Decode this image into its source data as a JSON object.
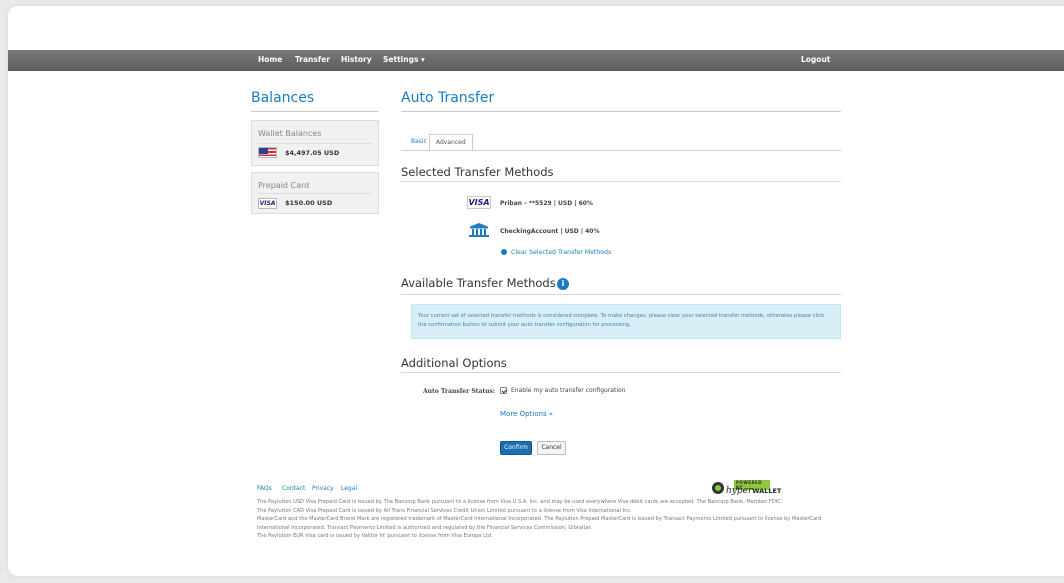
{
  "nav": {
    "home": "Home",
    "transfer": "Transfer",
    "history": "History",
    "settings": "Settings ▾",
    "logout": "Logout"
  },
  "balances": {
    "title": "Balances",
    "wallet": {
      "title": "Wallet Balances",
      "amount": "$4,497.05 USD",
      "icon": "us-flag-icon"
    },
    "prepaid": {
      "title": "Prepaid Card",
      "amount": "$150.00 USD",
      "icon": "visa-icon",
      "badge": "VISA"
    }
  },
  "page": {
    "title": "Auto Transfer",
    "tabs": [
      {
        "label": "Basic",
        "active": false
      },
      {
        "label": "Advanced",
        "active": true
      }
    ]
  },
  "selected_methods": {
    "heading": "Selected Transfer Methods",
    "items": [
      {
        "icon": "visa-icon",
        "badge": "VISA",
        "label": "Priban - **5529 | USD | 60%"
      },
      {
        "icon": "bank-icon",
        "label": "CheckingAccount | USD | 40%"
      }
    ],
    "clear_link": "Clear Selected Transfer Methods"
  },
  "available_methods": {
    "heading": "Available Transfer Methods",
    "info_icon": "i",
    "alert": "Your current set of selected transfer methods is considered complete. To make changes, please clear your selected transfer methods, otherwise please click the confirmation button to submit your auto transfer configuration for processing."
  },
  "additional_options": {
    "heading": "Additional Options",
    "status_label": "Auto Transfer Status:",
    "checkbox_label": "Enable my auto transfer configuration",
    "checkbox_checked": true,
    "more_options": "More Options »"
  },
  "actions": {
    "confirm": "Confirm",
    "cancel": "Cancel"
  },
  "footer": {
    "links": {
      "faqs": "FAQs",
      "contact": "Contact",
      "privacy": "Privacy",
      "legal": "Legal"
    },
    "logo": {
      "powered": "POWERED BY",
      "name_a": "hyper",
      "name_b": "WALLET"
    },
    "lines": [
      "The Paylution USD Visa Prepaid Card is issued by The Bancorp Bank pursuant to a license from Visa U.S.A. Inc. and may be used everywhere Visa debit cards are accepted. The Bancorp Bank. Member FDIC.",
      "The Paylution CAD Visa Prepaid Card is issued by All Trans Financial Services Credit Union Limited pursuant to a license from Visa International Inc.",
      "MasterCard and the MasterCard Brand Mark are registered trademark of MasterCard International Incorporated. The Paylution Prepaid MasterCard is issued by Transact Payments Limited pursuant to license by MasterCard International Incorporated. Transact Payments Limited is authorised and regulated by the Financial Services Commission, Gibraltar.",
      "The Paylution EUR Visa card is issued by Valitor hf. pursuant to license from Visa Europe Ltd."
    ]
  },
  "colors": {
    "accent": "#1c7cc0",
    "navbar": "#666666",
    "alert_bg": "#d9edf7",
    "primary_button": "#1a6fb0"
  }
}
